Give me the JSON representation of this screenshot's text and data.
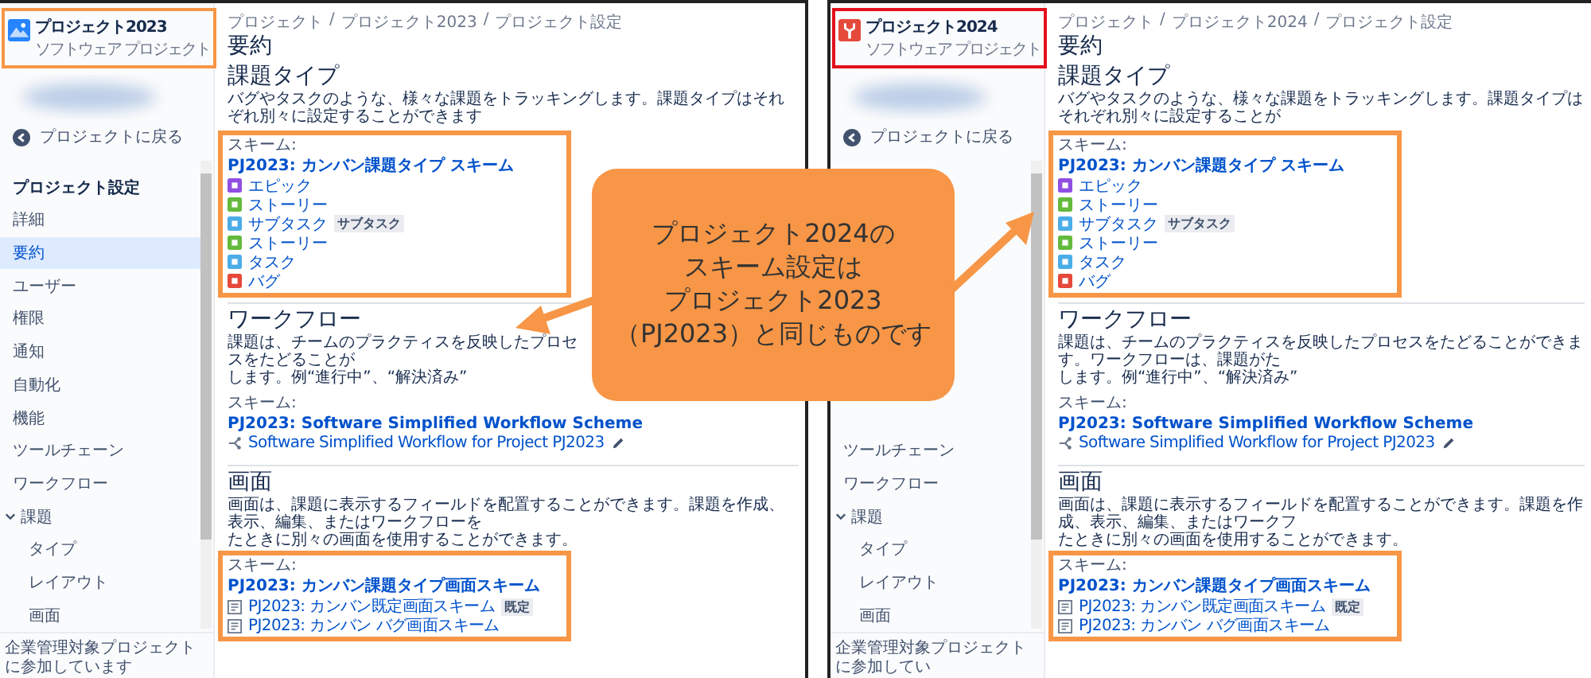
{
  "panels": [
    {
      "sidebar": {
        "project": {
          "name": "プロジェクト2023",
          "type": "ソフトウェア プロジェクト",
          "kind": "landscape",
          "color": "#f79646"
        },
        "back": "プロジェクトに戻る",
        "items": [
          {
            "label": "プロジェクト設定",
            "kind": "heading"
          },
          {
            "label": "詳細",
            "kind": "item",
            "selected": false
          },
          {
            "label": "要約",
            "kind": "item",
            "selected": true
          },
          {
            "label": "ユーザー",
            "kind": "item",
            "selected": false
          },
          {
            "label": "権限",
            "kind": "item",
            "selected": false
          },
          {
            "label": "通知",
            "kind": "item",
            "selected": false
          },
          {
            "label": "自動化",
            "kind": "item",
            "selected": false
          },
          {
            "label": "機能",
            "kind": "item",
            "selected": false
          },
          {
            "label": "ツールチェーン",
            "kind": "item",
            "selected": false
          },
          {
            "label": "ワークフロー",
            "kind": "item",
            "selected": false
          },
          {
            "label": "課題",
            "kind": "group",
            "selected": false,
            "expanded": true,
            "children": [
              {
                "label": "タイプ",
                "selected": false
              },
              {
                "label": "レイアウト",
                "selected": false
              },
              {
                "label": "画面",
                "selected": false
              }
            ]
          }
        ],
        "footer": "企業管理対象プロジェクトに参加しています"
      },
      "breadcrumb": [
        "プロジェクト",
        "プロジェクト2023",
        "プロジェクト設定"
      ],
      "breadcrumb_separator": "/",
      "title": "要約",
      "sections": [
        {
          "kind": "issue_types",
          "heading": "課題タイプ",
          "highlighted": true,
          "description": [
            "バグやタスクのような、様々な課題をトラッキングします。課題タイプはそれぞれ別々に設定することができます"
          ],
          "scheme_label": "スキーム:",
          "scheme": "PJ2023: カンバン課題タイプ スキーム",
          "items": [
            {
              "label": "エピック",
              "color": "#904ee2"
            },
            {
              "label": "ストーリー",
              "color": "#63ba3c"
            },
            {
              "label": "サブタスク",
              "color": "#4bade8",
              "badge": "サブタスク"
            },
            {
              "label": "ストーリー",
              "color": "#63ba3c"
            },
            {
              "label": "タスク",
              "color": "#4bade8"
            },
            {
              "label": "バグ",
              "color": "#e5493a"
            }
          ]
        },
        {
          "kind": "workflow",
          "heading": "ワークフロー",
          "description": [
            "課題は、チームのプラクティスを反映したプロセスをたどることが",
            "します。例“進行中”、“解決済み”"
          ],
          "scheme_label": "スキーム:",
          "scheme": "PJ2023: Software Simplified Workflow Scheme",
          "items": [
            {
              "label": "Software Simplified Workflow for Project PJ2023"
            }
          ]
        },
        {
          "kind": "screens",
          "heading": "画面",
          "highlighted": true,
          "description": [
            "画面は、課題に表示するフィールドを配置することができます。課題を作成、表示、編集、またはワークフローを",
            "たときに別々の画面を使用することができます。"
          ],
          "scheme_label": "スキーム:",
          "scheme": "PJ2023: カンバン課題タイプ画面スキーム",
          "items": [
            {
              "label": "PJ2023: カンバン既定画面スキーム",
              "badge": "既定"
            },
            {
              "label": "PJ2023: カンバン バグ画面スキーム"
            }
          ]
        }
      ]
    },
    {
      "sidebar": {
        "project": {
          "name": "プロジェクト2024",
          "type": "ソフトウェア プロジェクト",
          "kind": "tool",
          "color": "#e3101c"
        },
        "back": "プロジェクトに戻る",
        "items": [
          {
            "label": "ツールチェーン",
            "kind": "item",
            "selected": false
          },
          {
            "label": "ワークフロー",
            "kind": "item",
            "selected": false
          },
          {
            "label": "課題",
            "kind": "group",
            "selected": false,
            "expanded": true,
            "children": [
              {
                "label": "タイプ",
                "selected": false
              },
              {
                "label": "レイアウト",
                "selected": false
              },
              {
                "label": "画面",
                "selected": false
              }
            ]
          }
        ],
        "footer": "企業管理対象プロジェクトに参加してい"
      },
      "breadcrumb": [
        "プロジェクト",
        "プロジェクト2024",
        "プロジェクト設定"
      ],
      "breadcrumb_separator": "/",
      "title": "要約",
      "sections": [
        {
          "kind": "issue_types",
          "heading": "課題タイプ",
          "highlighted": true,
          "description": [
            "バグやタスクのような、様々な課題をトラッキングします。課題タイプはそれぞれ別々に設定することが"
          ],
          "scheme_label": "スキーム:",
          "scheme": "PJ2023: カンバン課題タイプ スキーム",
          "items": [
            {
              "label": "エピック",
              "color": "#904ee2"
            },
            {
              "label": "ストーリー",
              "color": "#63ba3c"
            },
            {
              "label": "サブタスク",
              "color": "#4bade8",
              "badge": "サブタスク"
            },
            {
              "label": "ストーリー",
              "color": "#63ba3c"
            },
            {
              "label": "タスク",
              "color": "#4bade8"
            },
            {
              "label": "バグ",
              "color": "#e5493a"
            }
          ]
        },
        {
          "kind": "workflow",
          "heading": "ワークフロー",
          "description": [
            "課題は、チームのプラクティスを反映したプロセスをたどることができます。ワークフローは、課題がた",
            "します。例“進行中”、“解決済み”"
          ],
          "scheme_label": "スキーム:",
          "scheme": "PJ2023: Software Simplified Workflow Scheme",
          "items": [
            {
              "label": "Software Simplified Workflow for Project PJ2023"
            }
          ]
        },
        {
          "kind": "screens",
          "heading": "画面",
          "highlighted": true,
          "description": [
            "画面は、課題に表示するフィールドを配置することができます。課題を作成、表示、編集、またはワークフ",
            "たときに別々の画面を使用することができます。"
          ],
          "scheme_label": "スキーム:",
          "scheme": "PJ2023: カンバン課題タイプ画面スキーム",
          "items": [
            {
              "label": "PJ2023: カンバン既定画面スキーム",
              "badge": "既定"
            },
            {
              "label": "PJ2023: カンバン バグ画面スキーム"
            }
          ]
        }
      ]
    }
  ],
  "callout": {
    "lines": [
      "プロジェクト2024の",
      "スキーム設定は",
      "プロジェクト2023",
      "（PJ2023）と同じものです"
    ]
  }
}
